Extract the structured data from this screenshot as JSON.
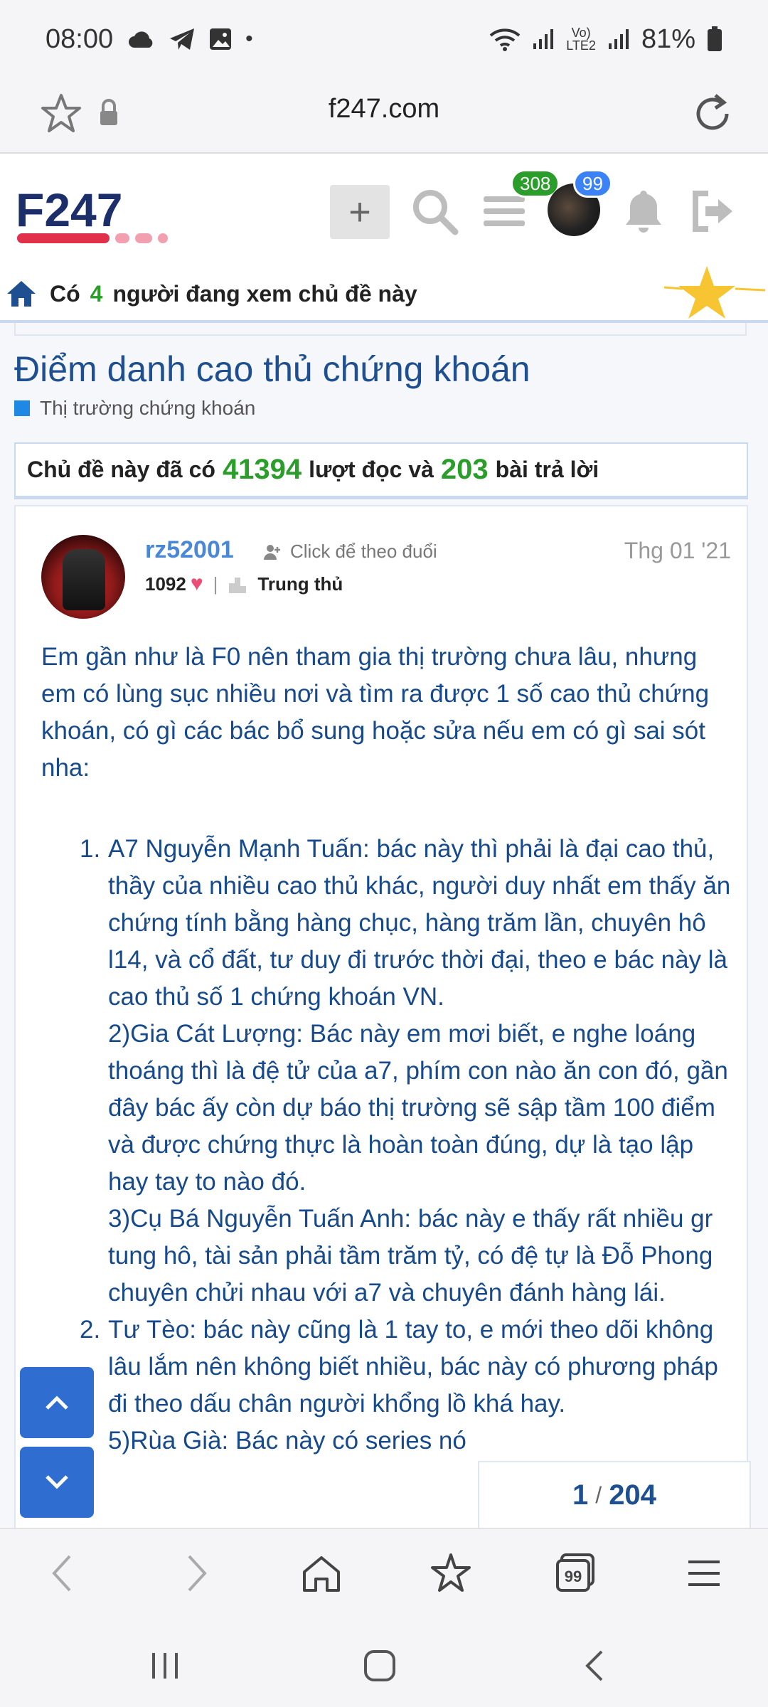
{
  "status_bar": {
    "time": "08:00",
    "battery": "81%",
    "network_label": "LTE2",
    "icons": [
      "cloud-icon",
      "telegram-icon",
      "gallery-icon",
      "dot-icon",
      "wifi-icon",
      "signal-icon",
      "volte-icon",
      "signal-icon-2",
      "battery-icon"
    ]
  },
  "browser": {
    "domain": "f247.com"
  },
  "header": {
    "logo_text": "F247",
    "badge_menu": "308",
    "badge_avatar": "99",
    "colors": {
      "badge_green": "#2a9d2a",
      "badge_blue": "#3b82f6",
      "logo_navy": "#1c2f6b",
      "logo_red": "#e0304a"
    }
  },
  "viewing": {
    "prefix": "Có",
    "count": "4",
    "suffix": "người đang xem chủ đề này"
  },
  "thread": {
    "title": "Điểm danh cao thủ chứng khoán",
    "forum": "Thị trường chứng khoán",
    "stats": {
      "prefix": "Chủ đề này đã có",
      "views": "41394",
      "views_label": "lượt đọc và",
      "replies": "203",
      "replies_label": "bài trả lời"
    }
  },
  "post": {
    "username": "rz52001",
    "follow_label": "Click để theo đuổi",
    "date": "Thg 01 '21",
    "likes": "1092",
    "rank": "Trung thủ",
    "intro": "Em gần như là F0 nên tham gia thị trường chưa lâu, nhưng em có lùng sục nhiều nơi và tìm ra được 1 số cao thủ chứng khoán, có gì các bác bổ sung hoặc sửa nếu em có gì sai sót nha:",
    "items": [
      {
        "num": "1.",
        "text": "A7 Nguyễn Mạnh Tuấn: bác này thì phải là đại cao thủ, thầy của nhiều cao thủ khác, người duy nhất em thấy ăn chứng tính bằng hàng chục, hàng trăm lần, chuyên hô l14, và cổ đất, tư duy đi trước thời đại, theo e bác này là cao thủ số 1 chứng khoán VN."
      },
      {
        "num": "",
        "text": "2)Gia Cát Lượng: Bác này em mơi biết, e nghe loáng thoáng thì là đệ tử của a7, phím con nào ăn con đó, gần đây bác ấy còn dự báo thị trường sẽ sập tầm 100 điểm và được chứng thực là hoàn toàn đúng, dự là tạo lập hay tay to nào đó."
      },
      {
        "num": "",
        "text": "3)Cụ Bá Nguyễn Tuấn Anh: bác này e thấy rất nhiều gr tung hô, tài sản phải tầm trăm tỷ, có đệ tự là Đỗ Phong chuyên chửi nhau với a7 và chuyên đánh hàng lái."
      },
      {
        "num": "2.",
        "text": "Tư Tèo: bác này cũng là 1 tay to, e mới theo dõi không lâu lắm nên không biết nhiều, bác này có phương pháp đi theo dấu chân người khổng lồ khá hay."
      },
      {
        "num": "",
        "text": "5)Rùa Già: Bác này có series nó"
      }
    ]
  },
  "pagination": {
    "current": "1",
    "total": "204"
  }
}
